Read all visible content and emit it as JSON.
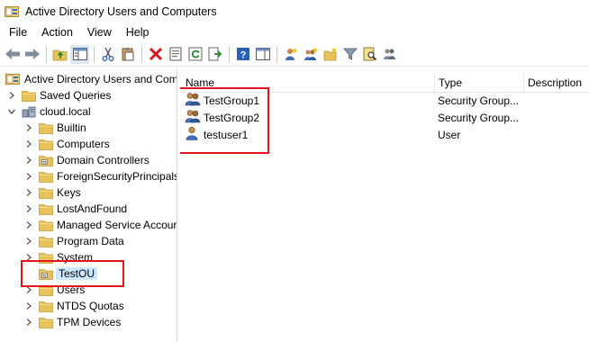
{
  "window": {
    "title": "Active Directory Users and Computers"
  },
  "menu": [
    "File",
    "Action",
    "View",
    "Help"
  ],
  "toolbar": {
    "buttons": [
      "back-icon",
      "forward-icon",
      "up-folder-icon",
      "show-hide-tree-icon",
      "cut-icon",
      "paste-icon",
      "delete-icon",
      "properties-icon",
      "refresh-icon",
      "export-list-icon",
      "help-icon",
      "console-view-icon",
      "new-user-icon",
      "new-group-icon",
      "new-ou-icon",
      "filter-icon",
      "find-icon",
      "add-to-group-icon"
    ]
  },
  "tree": {
    "root": "Active Directory Users and Com",
    "items": [
      {
        "label": "Saved Queries",
        "level": 1,
        "expander": "collapsed",
        "icon": "folder"
      },
      {
        "label": "cloud.local",
        "level": 1,
        "expander": "expanded",
        "icon": "domain"
      },
      {
        "label": "Builtin",
        "level": 2,
        "expander": "collapsed",
        "icon": "folder"
      },
      {
        "label": "Computers",
        "level": 2,
        "expander": "collapsed",
        "icon": "folder"
      },
      {
        "label": "Domain Controllers",
        "level": 2,
        "expander": "collapsed",
        "icon": "ou"
      },
      {
        "label": "ForeignSecurityPrincipals",
        "level": 2,
        "expander": "collapsed",
        "icon": "folder"
      },
      {
        "label": "Keys",
        "level": 2,
        "expander": "collapsed",
        "icon": "folder"
      },
      {
        "label": "LostAndFound",
        "level": 2,
        "expander": "collapsed",
        "icon": "folder"
      },
      {
        "label": "Managed Service Accour",
        "level": 2,
        "expander": "collapsed",
        "icon": "folder"
      },
      {
        "label": "Program Data",
        "level": 2,
        "expander": "collapsed",
        "icon": "folder"
      },
      {
        "label": "System",
        "level": 2,
        "expander": "collapsed",
        "icon": "folder"
      },
      {
        "label": "TestOU",
        "level": 2,
        "expander": "none",
        "icon": "ou",
        "selected": true
      },
      {
        "label": "Users",
        "level": 2,
        "expander": "collapsed",
        "icon": "folder"
      },
      {
        "label": "NTDS Quotas",
        "level": 2,
        "expander": "collapsed",
        "icon": "folder"
      },
      {
        "label": "TPM Devices",
        "level": 2,
        "expander": "collapsed",
        "icon": "folder"
      }
    ]
  },
  "list": {
    "columns": [
      "Name",
      "Type",
      "Description"
    ],
    "rows": [
      {
        "name": "TestGroup1",
        "type": "Security Group...",
        "description": "",
        "icon": "group"
      },
      {
        "name": "TestGroup2",
        "type": "Security Group...",
        "description": "",
        "icon": "group"
      },
      {
        "name": "testuser1",
        "type": "User",
        "description": "",
        "icon": "user"
      }
    ]
  },
  "colors": {
    "highlight": "#e8141c",
    "folder": "#e8c35a",
    "selection": "#cce8ff"
  }
}
